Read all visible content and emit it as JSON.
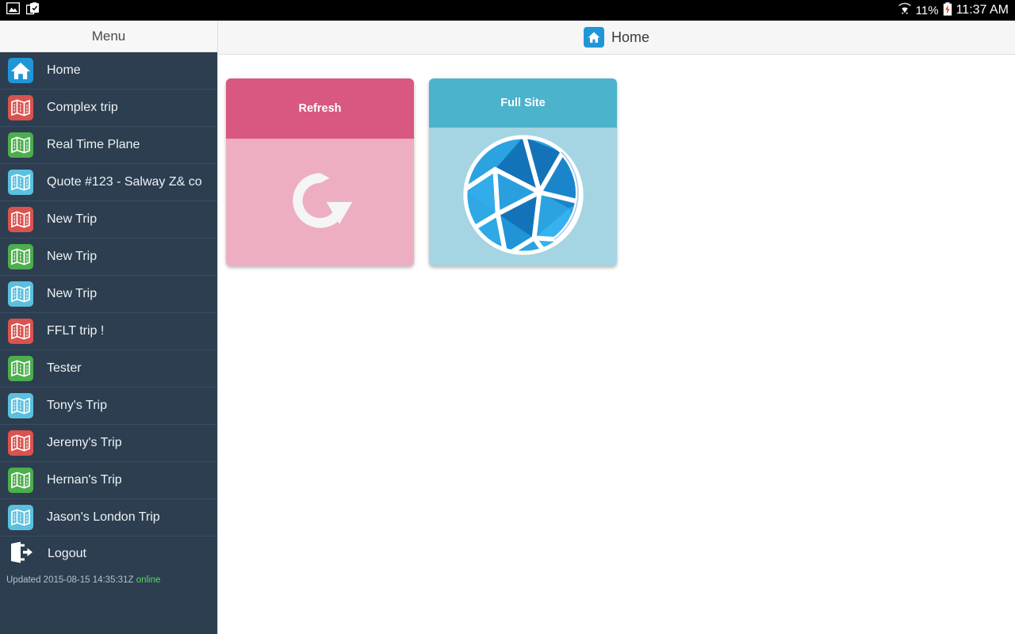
{
  "statusbar": {
    "left_icons": [
      "screenshot-image-icon",
      "clipboard-check-icon"
    ],
    "wifi_icon": "wifi-icon",
    "battery_percent": "11%",
    "battery_icon": "battery-charging-icon",
    "clock": "11:37 AM"
  },
  "sidebar": {
    "header": "Menu",
    "items": [
      {
        "label": "Home",
        "icon": "home-icon",
        "color": "#2196d6"
      },
      {
        "label": "Complex trip",
        "icon": "map-icon",
        "color": "#d9534f"
      },
      {
        "label": "Real Time Plane",
        "icon": "map-icon",
        "color": "#4cae4c"
      },
      {
        "label": "Quote #123 - Salway Z& co",
        "icon": "map-icon",
        "color": "#5bc0de"
      },
      {
        "label": "New Trip",
        "icon": "map-icon",
        "color": "#d9534f"
      },
      {
        "label": "New Trip",
        "icon": "map-icon",
        "color": "#4cae4c"
      },
      {
        "label": "New Trip",
        "icon": "map-icon",
        "color": "#5bc0de"
      },
      {
        "label": "FFLT trip !",
        "icon": "map-icon",
        "color": "#d9534f"
      },
      {
        "label": "Tester",
        "icon": "map-icon",
        "color": "#4cae4c"
      },
      {
        "label": "Tony's Trip",
        "icon": "map-icon",
        "color": "#5bc0de"
      },
      {
        "label": "Jeremy's Trip",
        "icon": "map-icon",
        "color": "#d9534f"
      },
      {
        "label": "Hernan's Trip",
        "icon": "map-icon",
        "color": "#4cae4c"
      },
      {
        "label": "Jason's London Trip",
        "icon": "map-icon",
        "color": "#5bc0de"
      }
    ],
    "logout": {
      "label": "Logout",
      "icon": "logout-icon"
    },
    "footer": {
      "updated_text": "Updated 2015-08-15 14:35:31Z",
      "status": "online",
      "status_color": "#5cd65c"
    },
    "background_color": "#2c3e50"
  },
  "main": {
    "header": {
      "title": "Home",
      "icon": "home-icon"
    },
    "tiles": [
      {
        "label": "Refresh",
        "icon": "refresh-icon",
        "head_color": "#d9587f",
        "body_color": "#eeaec1"
      },
      {
        "label": "Full Site",
        "icon": "globe-network-icon",
        "head_color": "#4bb3cb",
        "body_color": "#a5d4e2"
      }
    ]
  }
}
